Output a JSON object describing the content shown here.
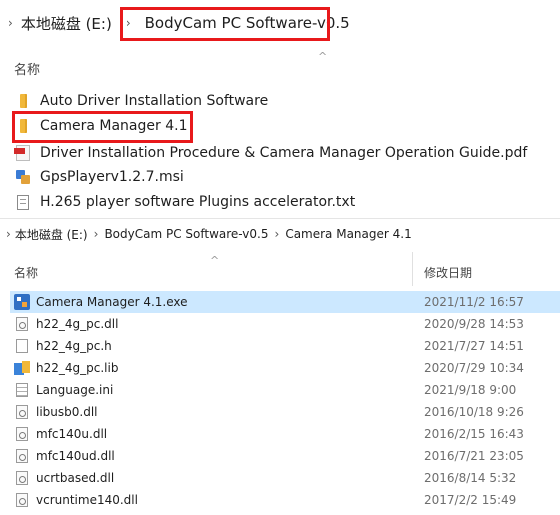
{
  "top_pane": {
    "breadcrumb": {
      "segments": [
        "本地磁盘 (E:)",
        "BodyCam PC Software-v0.5"
      ]
    },
    "column_header": "名称",
    "items": [
      {
        "name": "Auto Driver Installation Software",
        "icon": "folder-icon"
      },
      {
        "name": "Camera Manager 4.1",
        "icon": "folder-icon"
      },
      {
        "name": "Driver Installation Procedure & Camera Manager Operation Guide.pdf",
        "icon": "pdf-icon"
      },
      {
        "name": "GpsPlayerv1.2.7.msi",
        "icon": "installer-icon"
      },
      {
        "name": "H.265 player software Plugins accelerator.txt",
        "icon": "text-file-icon"
      }
    ]
  },
  "bottom_pane": {
    "breadcrumb": {
      "segments": [
        "本地磁盘 (E:)",
        "BodyCam PC Software-v0.5",
        "Camera Manager 4.1"
      ]
    },
    "columns": {
      "name": "名称",
      "modified": "修改日期"
    },
    "files": [
      {
        "name": "Camera Manager 4.1.exe",
        "modified": "2021/11/2 16:57",
        "icon": "exe-icon",
        "selected": true
      },
      {
        "name": "h22_4g_pc.dll",
        "modified": "2020/9/28 14:53",
        "icon": "dll-icon"
      },
      {
        "name": "h22_4g_pc.h",
        "modified": "2021/7/27 14:51",
        "icon": "header-file-icon"
      },
      {
        "name": "h22_4g_pc.lib",
        "modified": "2020/7/29 10:34",
        "icon": "lib-icon"
      },
      {
        "name": "Language.ini",
        "modified": "2021/9/18 9:00",
        "icon": "ini-icon"
      },
      {
        "name": "libusb0.dll",
        "modified": "2016/10/18 9:26",
        "icon": "dll-icon"
      },
      {
        "name": "mfc140u.dll",
        "modified": "2016/2/15 16:43",
        "icon": "dll-icon"
      },
      {
        "name": "mfc140ud.dll",
        "modified": "2016/7/21 23:05",
        "icon": "dll-icon"
      },
      {
        "name": "ucrtbased.dll",
        "modified": "2016/8/14 5:32",
        "icon": "dll-icon"
      },
      {
        "name": "vcruntime140.dll",
        "modified": "2017/2/2 15:49",
        "icon": "dll-icon"
      }
    ],
    "selection_color": "#cce8ff"
  },
  "highlight_color": "#e8191b",
  "separator_glyph": "›",
  "sort_glyph": "^"
}
